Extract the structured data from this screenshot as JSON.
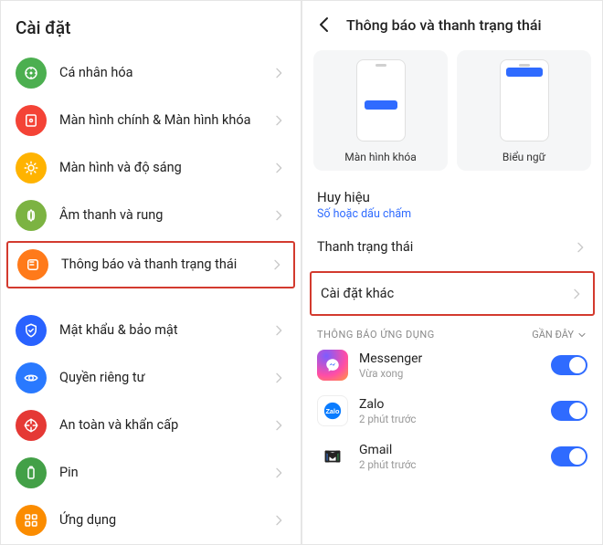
{
  "left": {
    "header": "Cài đặt",
    "items": [
      {
        "label": "Cá nhân hóa",
        "icon": "personalize-icon",
        "bg": "bg-green"
      },
      {
        "label": "Màn hình chính & Màn hình khóa",
        "icon": "home-lock-icon",
        "bg": "bg-red"
      },
      {
        "label": "Màn hình và độ sáng",
        "icon": "brightness-icon",
        "bg": "bg-yellow"
      },
      {
        "label": "Âm thanh và rung",
        "icon": "sound-icon",
        "bg": "bg-limegreen"
      },
      {
        "label": "Thông báo và thanh trạng thái",
        "icon": "notification-icon",
        "bg": "bg-orange",
        "highlight": true
      },
      {
        "gap": true
      },
      {
        "label": "Mật khẩu & bảo mật",
        "icon": "security-icon",
        "bg": "bg-blue"
      },
      {
        "label": "Quyền riêng tư",
        "icon": "privacy-icon",
        "bg": "bg-blue2"
      },
      {
        "label": "An toàn và khẩn cấp",
        "icon": "emergency-icon",
        "bg": "bg-red2"
      },
      {
        "label": "Pin",
        "icon": "battery-icon",
        "bg": "bg-green2"
      },
      {
        "label": "Ứng dụng",
        "icon": "apps-icon",
        "bg": "bg-orange2"
      }
    ]
  },
  "right": {
    "title": "Thông báo và thanh trạng thái",
    "preview": {
      "lock_label": "Màn hình khóa",
      "banner_label": "Biểu ngữ"
    },
    "badge": {
      "title": "Huy hiệu",
      "sub": "Số hoặc dấu chấm"
    },
    "statusbar_label": "Thanh trạng thái",
    "other_label": "Cài đặt khác",
    "app_section": {
      "heading": "THÔNG BÁO ỨNG DỤNG",
      "sort_label": "GẦN ĐÂY"
    },
    "apps": [
      {
        "name": "Messenger",
        "sub": "Vừa xong",
        "icon": "messenger"
      },
      {
        "name": "Zalo",
        "sub": "2 phút trước",
        "icon": "zalo"
      },
      {
        "name": "Gmail",
        "sub": "2 phút trước",
        "icon": "gmail"
      }
    ]
  }
}
